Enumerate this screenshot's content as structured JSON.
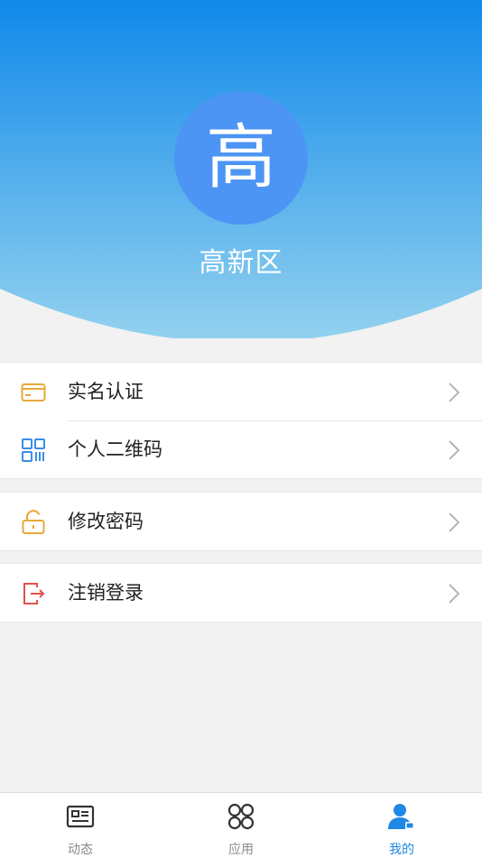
{
  "profile": {
    "avatar_text": "高",
    "name": "高新区"
  },
  "menu": {
    "groups": [
      [
        {
          "label": "实名认证",
          "icon": "id-card-icon",
          "color": "#e8a93a"
        },
        {
          "label": "个人二维码",
          "icon": "qr-code-icon",
          "color": "#3a8ee6"
        }
      ],
      [
        {
          "label": "修改密码",
          "icon": "unlock-icon",
          "color": "#e8a93a"
        }
      ],
      [
        {
          "label": "注销登录",
          "icon": "logout-icon",
          "color": "#e0524c"
        }
      ]
    ]
  },
  "tabbar": {
    "tabs": [
      {
        "label": "动态",
        "icon": "news-icon",
        "active": false
      },
      {
        "label": "应用",
        "icon": "apps-icon",
        "active": false
      },
      {
        "label": "我的",
        "icon": "user-icon",
        "active": true
      }
    ]
  },
  "colors": {
    "header_top": "#1089ea",
    "header_bottom": "#8fd0ee",
    "accent": "#1e88e5",
    "avatar_bg": "#4c95f4"
  }
}
